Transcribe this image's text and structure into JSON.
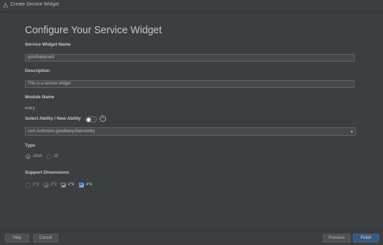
{
  "window": {
    "title": "Create Service Widget"
  },
  "page": {
    "heading": "Configure Your Service Widget"
  },
  "widget_name": {
    "label": "Service Widget Name",
    "value": "goodbabycard"
  },
  "description": {
    "label": "Description",
    "value": "This is a service widget"
  },
  "module": {
    "label": "Module Name",
    "value": "entry"
  },
  "ability": {
    "label": "Select Ability / New Ability",
    "toggle_on": false,
    "help_symbol": "?",
    "selected": "com.isoftstone.goodbaby.MainAbility"
  },
  "type": {
    "label": "Type",
    "options": [
      {
        "label": "JAVA",
        "selected": true
      },
      {
        "label": "JS",
        "selected": false
      }
    ]
  },
  "dimensions": {
    "label": "Support Dimensions",
    "options": [
      {
        "label": "1*2",
        "checked": false,
        "enabled": true
      },
      {
        "label": "2*2",
        "checked": true,
        "enabled": false
      },
      {
        "label": "2*4",
        "checked": true,
        "enabled": true
      },
      {
        "label": "4*4",
        "checked": true,
        "enabled": true
      }
    ]
  },
  "footer": {
    "help": "Help",
    "cancel": "Cancel",
    "previous": "Previous",
    "finish": "Finish"
  },
  "colors": {
    "background": "#3c3f41",
    "field": "#45494a",
    "accent": "#365880",
    "checkbox_blue": "#3d70c9"
  },
  "icons": {
    "app": "harmony-logo-icon"
  }
}
